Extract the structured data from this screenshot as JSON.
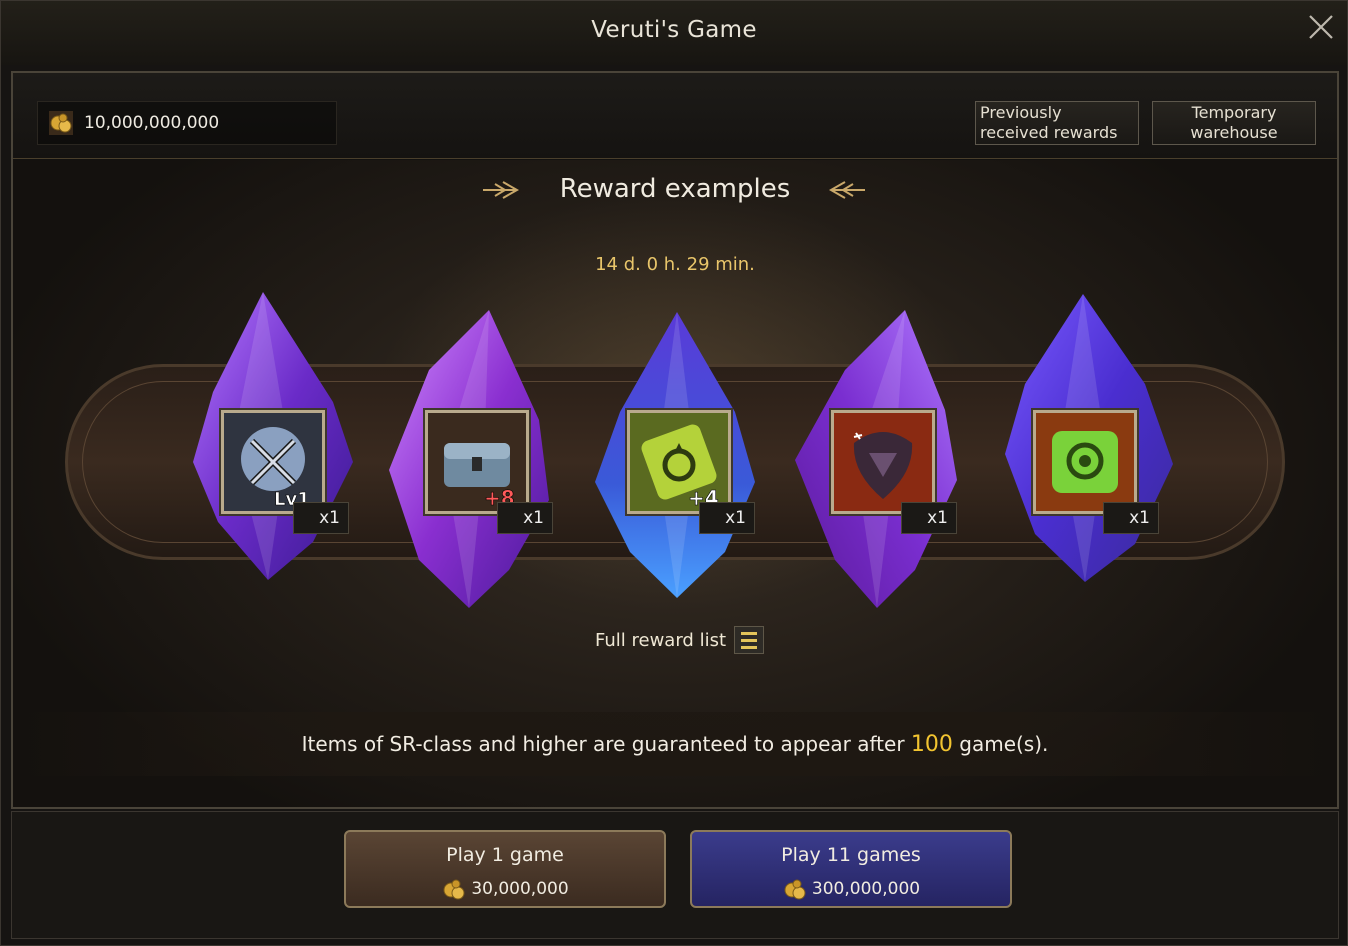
{
  "window": {
    "title": "Veruti's Game"
  },
  "topbar": {
    "currency_value": "10,000,000,000",
    "previously_received_label": "Previously received rewards",
    "temporary_warehouse_label": "Temporary warehouse"
  },
  "rewards": {
    "title": "Reward examples",
    "timer": "14 d. 0 h. 29 min.",
    "items": [
      {
        "icon": "sword-crest-icon",
        "badge": "Lv1",
        "quantity": "x1",
        "crystal_color": "#7a34d0"
      },
      {
        "icon": "treasure-chest-icon",
        "badge": "+8",
        "quantity": "x1",
        "crystal_color": "#9a3cd6"
      },
      {
        "icon": "ring-ticket-icon",
        "badge": "+4",
        "quantity": "x1",
        "crystal_color": "#3c4fd6"
      },
      {
        "icon": "dark-gem-icon",
        "badge": "",
        "quantity": "x1",
        "crystal_color": "#8a3ad0"
      },
      {
        "icon": "green-scroll-icon",
        "badge": "",
        "quantity": "x1",
        "crystal_color": "#5a3ae0"
      }
    ],
    "full_reward_list_label": "Full reward list"
  },
  "guarantee": {
    "prefix": "Items of SR-class and higher are guaranteed to appear after ",
    "count": "100",
    "suffix": " game(s)."
  },
  "play": {
    "one": {
      "label": "Play 1 game",
      "cost": "30,000,000"
    },
    "eleven": {
      "label": "Play 11 games",
      "cost": "300,000,000"
    }
  },
  "colors": {
    "accent_gold": "#f2c430",
    "timer": "#e8c56a",
    "play_one": "#4a3828",
    "play_eleven": "#30307a"
  }
}
